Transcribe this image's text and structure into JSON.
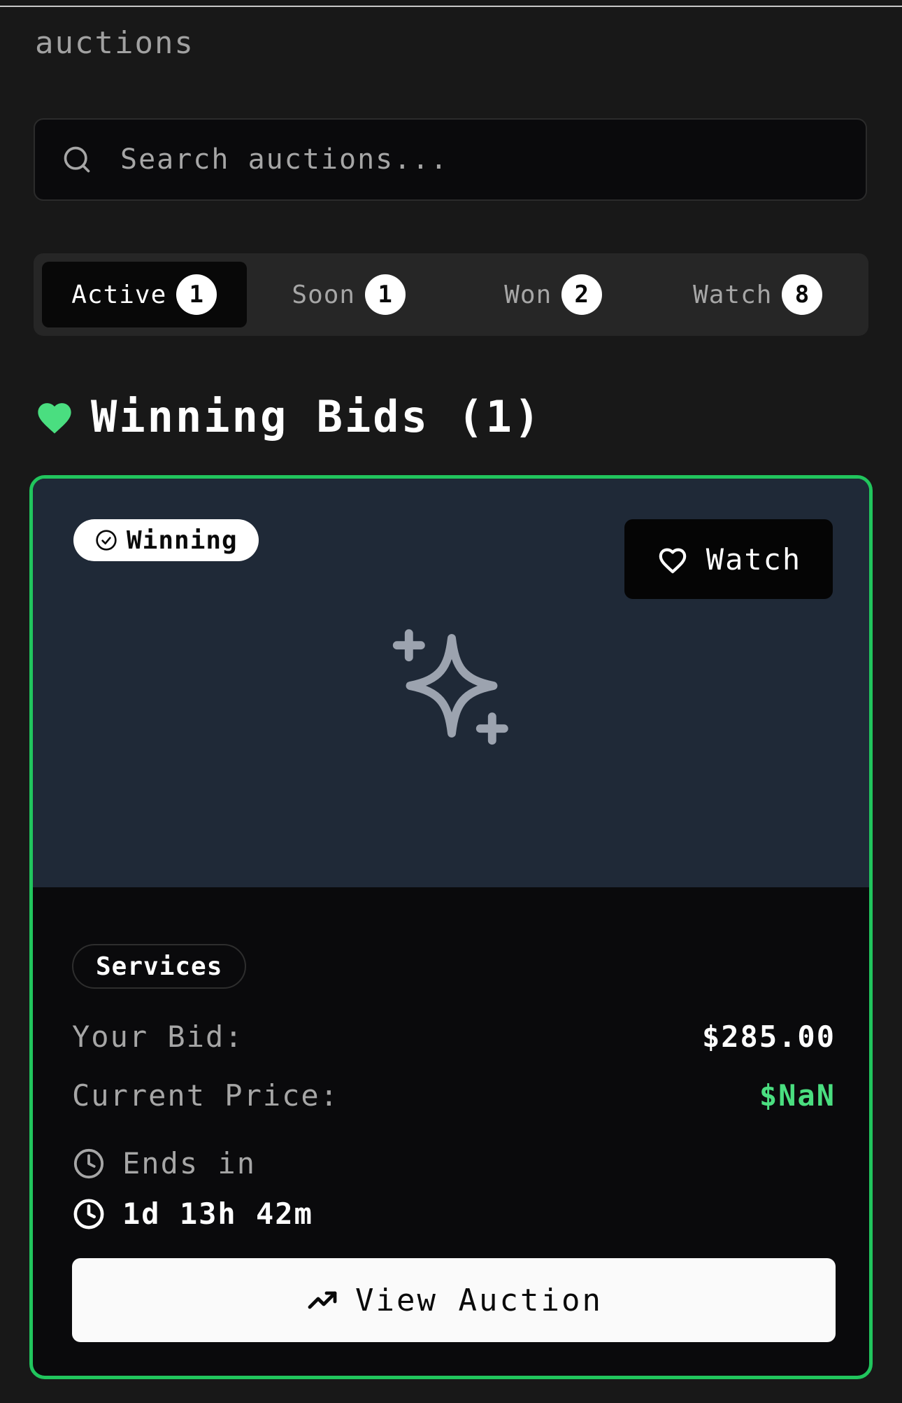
{
  "header": {
    "subtitle": "auctions"
  },
  "search": {
    "placeholder": "Search auctions...",
    "value": "",
    "icon": "search-icon"
  },
  "tabs": [
    {
      "label": "Active",
      "count": "1",
      "active": true
    },
    {
      "label": "Soon",
      "count": "1",
      "active": false
    },
    {
      "label": "Won",
      "count": "2",
      "active": false
    },
    {
      "label": "Watch",
      "count": "8",
      "active": false
    }
  ],
  "section": {
    "title": "Winning Bids (1)",
    "icon": "heart-icon",
    "icon_color": "#4ade80"
  },
  "card": {
    "border_color": "#21c55d",
    "status_badge": "Winning",
    "status_icon": "check-circle-icon",
    "watch_label": "Watch",
    "watch_icon": "heart-outline-icon",
    "placeholder_icon": "sparkles-icon",
    "category": "Services",
    "your_bid_label": "Your Bid:",
    "your_bid_value": "$285.00",
    "current_price_label": "Current Price:",
    "current_price_value": "$NaN",
    "price_color": "#4ade80",
    "ends_label": "Ends in",
    "ends_value": "1d 13h 42m",
    "clock_icon": "clock-icon",
    "view_button_label": "View Auction",
    "view_button_icon": "trending-up-icon"
  }
}
